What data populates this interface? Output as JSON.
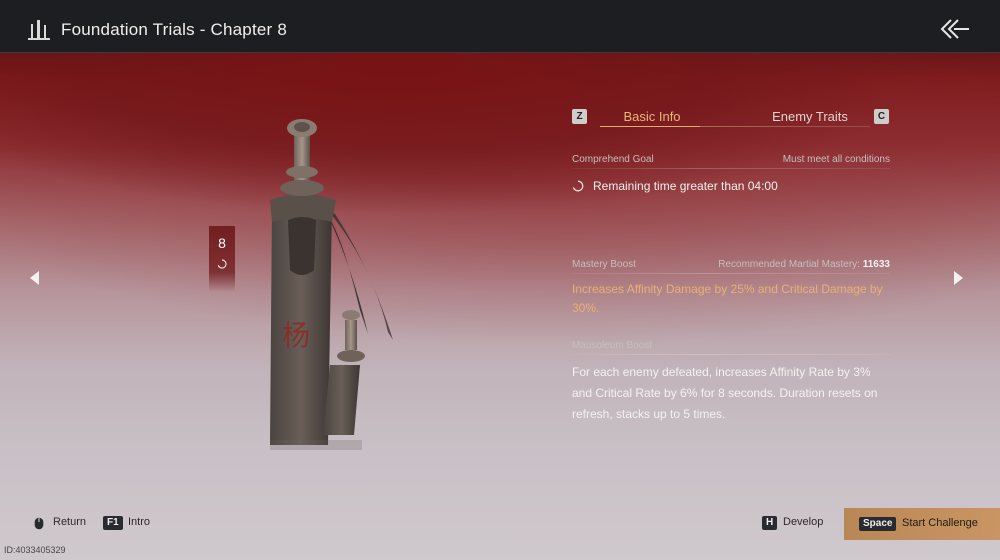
{
  "header": {
    "title": "Foundation Trials - Chapter 8",
    "logo_icon": "tower-icon",
    "back_icon": "double-chevron-back-icon"
  },
  "chapter": {
    "number": "8",
    "status_icon": "loading-circle-icon"
  },
  "tabs": {
    "left_key": "Z",
    "basic_info": "Basic Info",
    "enemy_traits": "Enemy Traits",
    "right_key": "C",
    "active": "Basic Info"
  },
  "comprehend": {
    "label": "Comprehend Goal",
    "condition": "Must meet all conditions",
    "goal": "Remaining time greater than 04:00"
  },
  "mastery": {
    "label": "Mastery Boost",
    "recommended_label": "Recommended Martial Mastery:",
    "recommended_value": "11633",
    "text": "Increases Affinity Damage by 25% and Critical Damage by 30%."
  },
  "mausoleum": {
    "label": "Mausoleum Boost",
    "text": "For each enemy defeated, increases Affinity Rate by 3% and Critical Rate by 6% for 8 seconds. Duration resets on refresh, stacks up to 5 times."
  },
  "footer": {
    "return_label": "Return",
    "intro_key": "F1",
    "intro_label": "Intro",
    "develop_key": "H",
    "develop_label": "Develop",
    "start_key": "Space",
    "start_label": "Start Challenge",
    "id_text": "ID:4033405329"
  },
  "colors": {
    "accent": "#e9b67a",
    "start_button": "#c08e5c",
    "topbar": "#1d1e22"
  }
}
